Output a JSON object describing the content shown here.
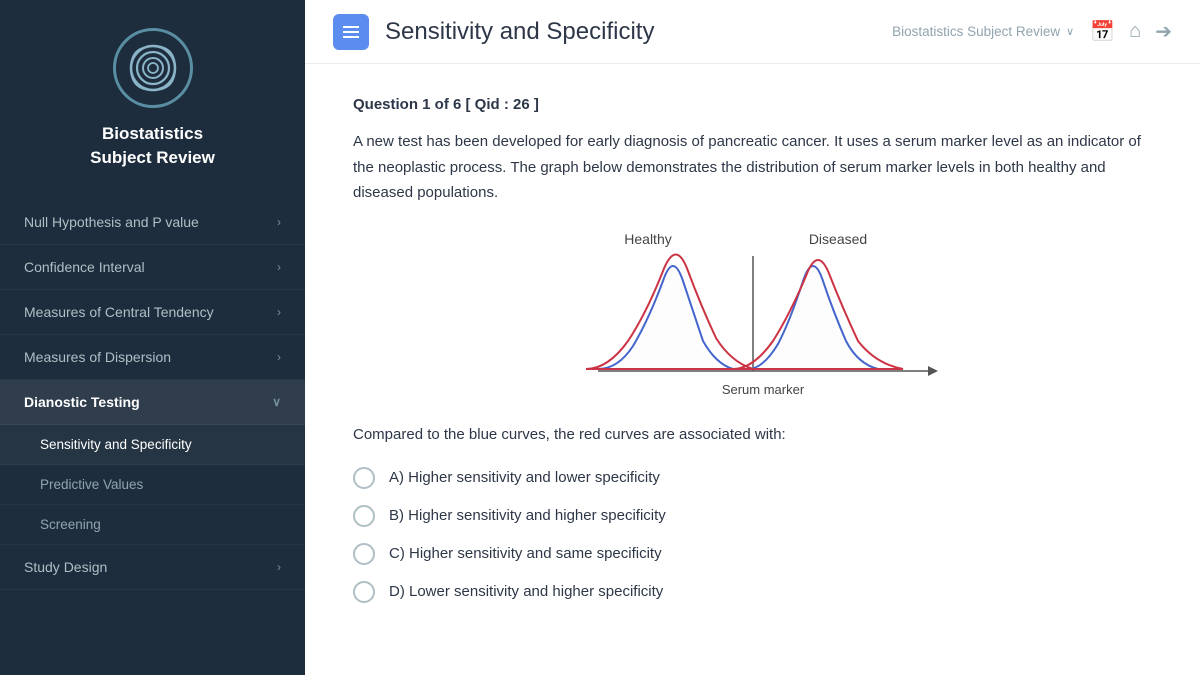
{
  "sidebar": {
    "app_name_line1": "Biostatistics",
    "app_name_line2": "Subject Review",
    "nav_items": [
      {
        "id": "null-hypothesis",
        "label": "Null Hypothesis and P value",
        "has_children": false,
        "active": false,
        "chevron": "›"
      },
      {
        "id": "confidence-interval",
        "label": "Confidence Interval",
        "has_children": false,
        "active": false,
        "chevron": "›"
      },
      {
        "id": "central-tendency",
        "label": "Measures of Central Tendency",
        "has_children": false,
        "active": false,
        "chevron": "›"
      },
      {
        "id": "dispersion",
        "label": "Measures of Dispersion",
        "has_children": false,
        "active": false,
        "chevron": "›"
      },
      {
        "id": "diagnostic-testing",
        "label": "Dianostic Testing",
        "has_children": true,
        "active": true,
        "chevron": "∨"
      }
    ],
    "sub_items": [
      {
        "id": "sensitivity-specificity",
        "label": "Sensitivity and Specificity",
        "active": true
      },
      {
        "id": "predictive-values",
        "label": "Predictive Values",
        "active": false
      },
      {
        "id": "screening",
        "label": "Screening",
        "active": false
      }
    ],
    "study_design_label": "Study Design",
    "study_design_chevron": "›"
  },
  "header": {
    "title": "Sensitivity and Specificity",
    "breadcrumb": "Biostatistics Subject Review",
    "menu_icon": "≡"
  },
  "content": {
    "question_label": "Question 1 of 6 [ Qid : 26 ]",
    "question_text": "A new test has been developed for early diagnosis of pancreatic cancer.  It uses a serum marker level as an indicator of the neoplastic process.  The graph below demonstrates the distribution of serum marker levels in both healthy and diseased populations.",
    "compare_text": "Compared to the blue curves, the red curves are associated with:",
    "options": [
      {
        "id": "A",
        "label": "A)  Higher sensitivity and lower specificity"
      },
      {
        "id": "B",
        "label": "B)  Higher sensitivity and higher specificity"
      },
      {
        "id": "C",
        "label": "C)  Higher sensitivity and same specificity"
      },
      {
        "id": "D",
        "label": "D)  Lower sensitivity and higher specificity"
      }
    ],
    "chart": {
      "healthy_label": "Healthy",
      "diseased_label": "Diseased",
      "xaxis_label": "Serum marker"
    }
  }
}
